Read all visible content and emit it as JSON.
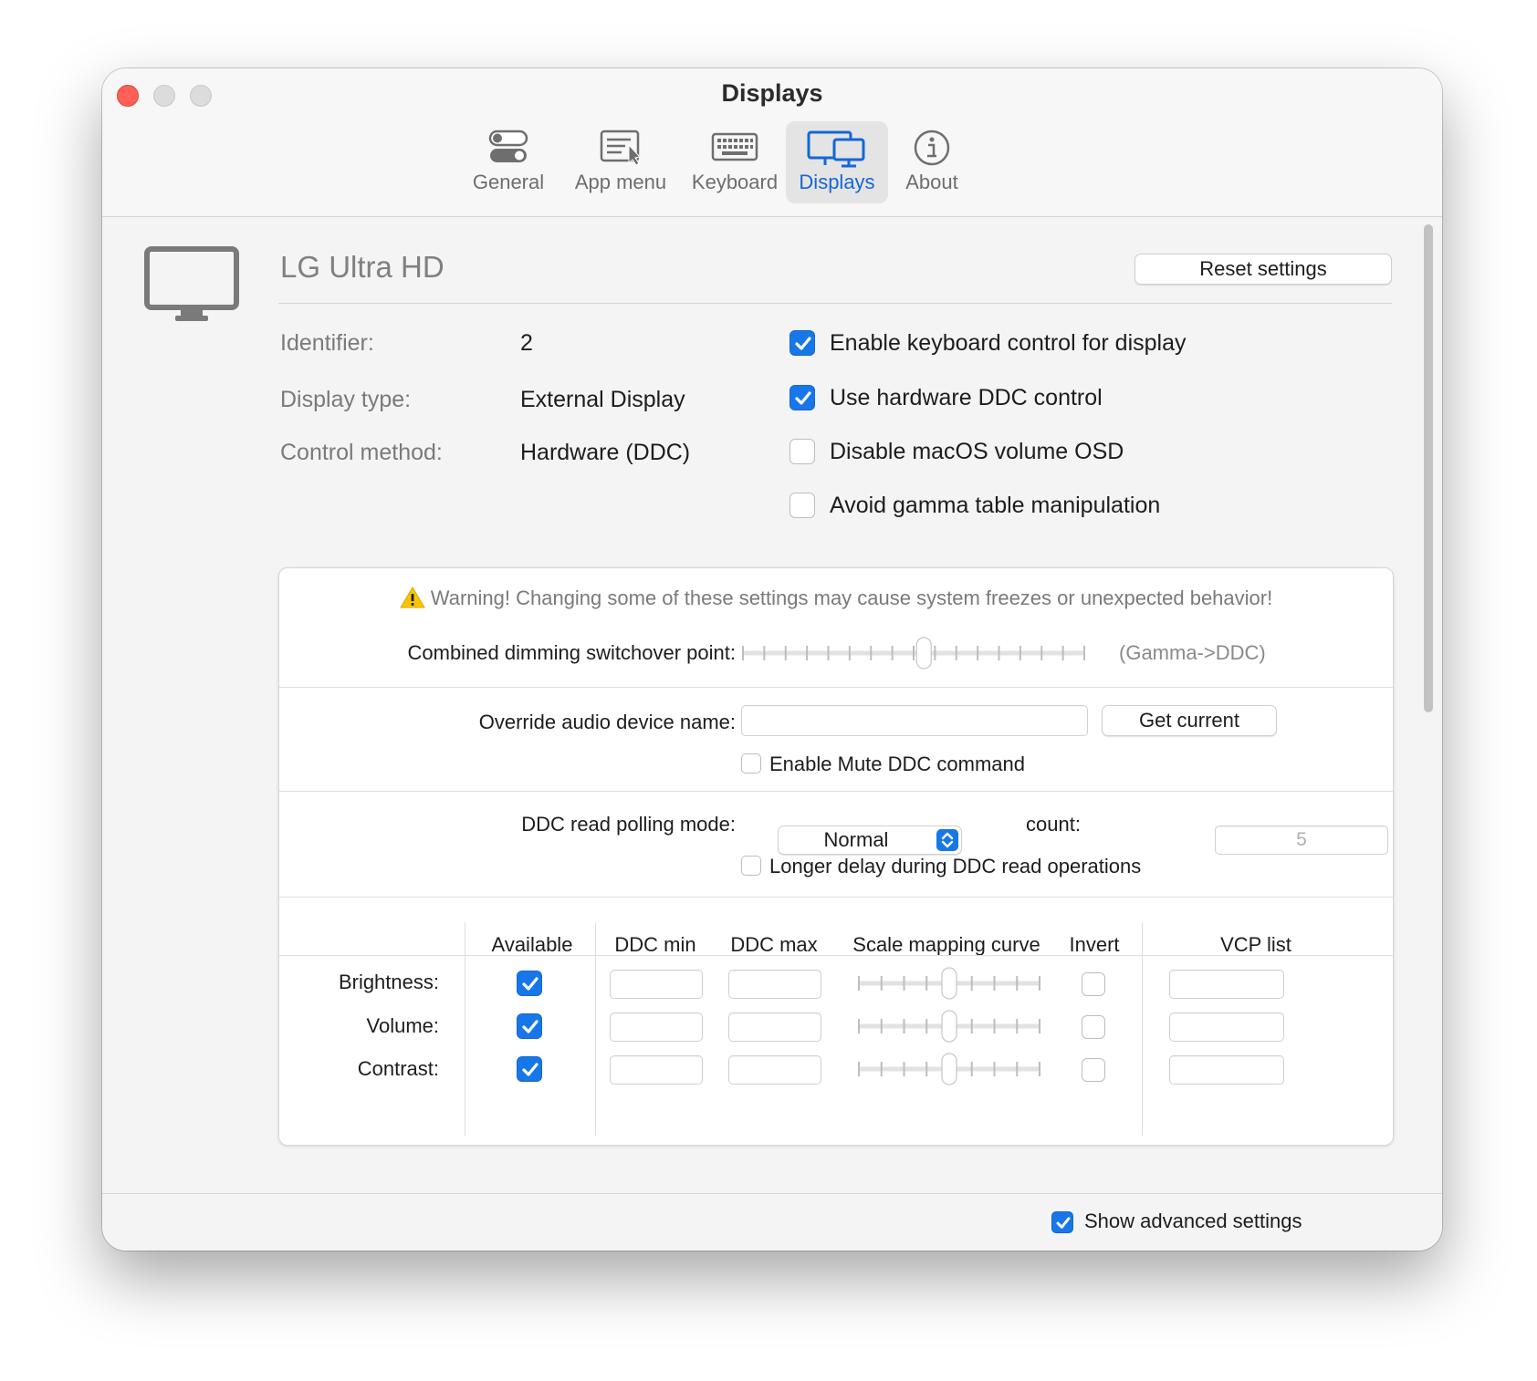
{
  "window": {
    "title": "Displays"
  },
  "toolbar": {
    "tabs": [
      {
        "label": "General",
        "icon": "toggles-icon"
      },
      {
        "label": "App menu",
        "icon": "app-menu-icon"
      },
      {
        "label": "Keyboard",
        "icon": "keyboard-icon"
      },
      {
        "label": "Displays",
        "icon": "displays-icon",
        "active": true
      },
      {
        "label": "About",
        "icon": "info-icon"
      }
    ]
  },
  "display": {
    "name": "LG Ultra HD",
    "reset_label": "Reset settings",
    "identifier_label": "Identifier:",
    "identifier_value": "2",
    "type_label": "Display type:",
    "type_value": "External Display",
    "method_label": "Control method:",
    "method_value": "Hardware (DDC)",
    "options": [
      {
        "label": "Enable keyboard control for display",
        "checked": true
      },
      {
        "label": "Use hardware DDC control",
        "checked": true
      },
      {
        "label": "Disable macOS volume OSD",
        "checked": false
      },
      {
        "label": "Avoid gamma table manipulation",
        "checked": false
      }
    ]
  },
  "advanced": {
    "warning": "Warning! Changing some of these settings may cause system freezes or unexpected behavior!",
    "switchover_label": "Combined dimming switchover point:",
    "switchover_suffix": "(Gamma->DDC)",
    "switchover_value": 0.53,
    "audio_label": "Override audio device name:",
    "audio_value": "",
    "get_current_label": "Get current",
    "mute_label": "Enable Mute DDC command",
    "mute_checked": false,
    "polling_label": "DDC read polling mode:",
    "polling_value": "Normal",
    "count_label": "count:",
    "count_value": "5",
    "delay_label": "Longer delay during DDC read operations",
    "delay_checked": false,
    "columns": [
      "Available",
      "DDC min",
      "DDC max",
      "Scale mapping curve",
      "Invert",
      "VCP list"
    ],
    "rows": [
      {
        "label": "Brightness:",
        "available": true,
        "ddc_min": "",
        "ddc_max": "",
        "curve": 0.5,
        "invert": false,
        "vcp": ""
      },
      {
        "label": "Volume:",
        "available": true,
        "ddc_min": "",
        "ddc_max": "",
        "curve": 0.5,
        "invert": false,
        "vcp": ""
      },
      {
        "label": "Contrast:",
        "available": true,
        "ddc_min": "",
        "ddc_max": "",
        "curve": 0.5,
        "invert": false,
        "vcp": ""
      }
    ]
  },
  "footer": {
    "show_advanced_label": "Show advanced settings",
    "show_advanced_checked": true
  },
  "colors": {
    "accent": "#1877e8",
    "close": "#fe5f57",
    "active_tab_text": "#1467d6"
  }
}
